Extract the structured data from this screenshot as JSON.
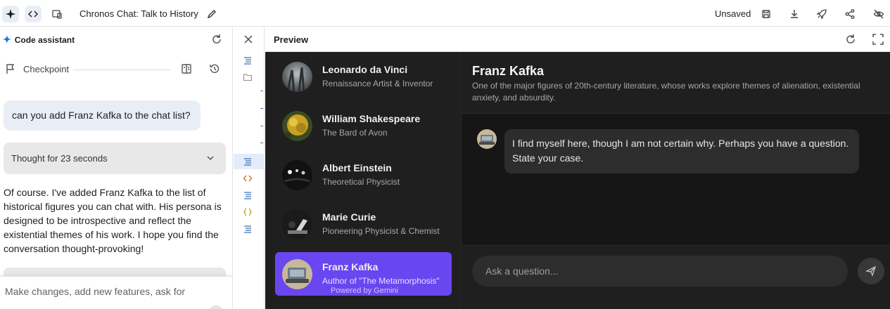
{
  "topbar": {
    "app_title": "Chronos Chat: Talk to History",
    "status": "Unsaved"
  },
  "assistant": {
    "title": "Code assistant",
    "checkpoint_label": "Checkpoint",
    "user_message": "can you add Franz Kafka to the chat list?",
    "thought_label": "Thought for 23 seconds",
    "reply": "Of course. I've added Franz Kafka to the list of historical figures you can chat with. His persona is designed to be introspective and reflect the existential themes of his work. I hope you find the conversation thought-provoking!",
    "input_placeholder": "Make changes, add new features, ask for"
  },
  "preview": {
    "title": "Preview"
  },
  "figures": [
    {
      "name": "Leonardo da Vinci",
      "subtitle": "Renaissance Artist & Inventor"
    },
    {
      "name": "William Shakespeare",
      "subtitle": "The Bard of Avon"
    },
    {
      "name": "Albert Einstein",
      "subtitle": "Theoretical Physicist"
    },
    {
      "name": "Marie Curie",
      "subtitle": "Pioneering Physicist & Chemist"
    },
    {
      "name": "Franz Kafka",
      "subtitle": "Author of \"The Metamorphosis\""
    }
  ],
  "powered_by": "Powered by Gemini",
  "chat": {
    "name": "Franz Kafka",
    "description": "One of the major figures of 20th-century literature, whose works explore themes of alienation, existential anxiety, and absurdity.",
    "message": "I find myself here, though I am not certain why. Perhaps you have a question. State your case.",
    "input_placeholder": "Ask a question..."
  },
  "colors": {
    "accent": "#6a46f0",
    "app_background": "#161616",
    "panel_background": "#1f1f1f"
  }
}
